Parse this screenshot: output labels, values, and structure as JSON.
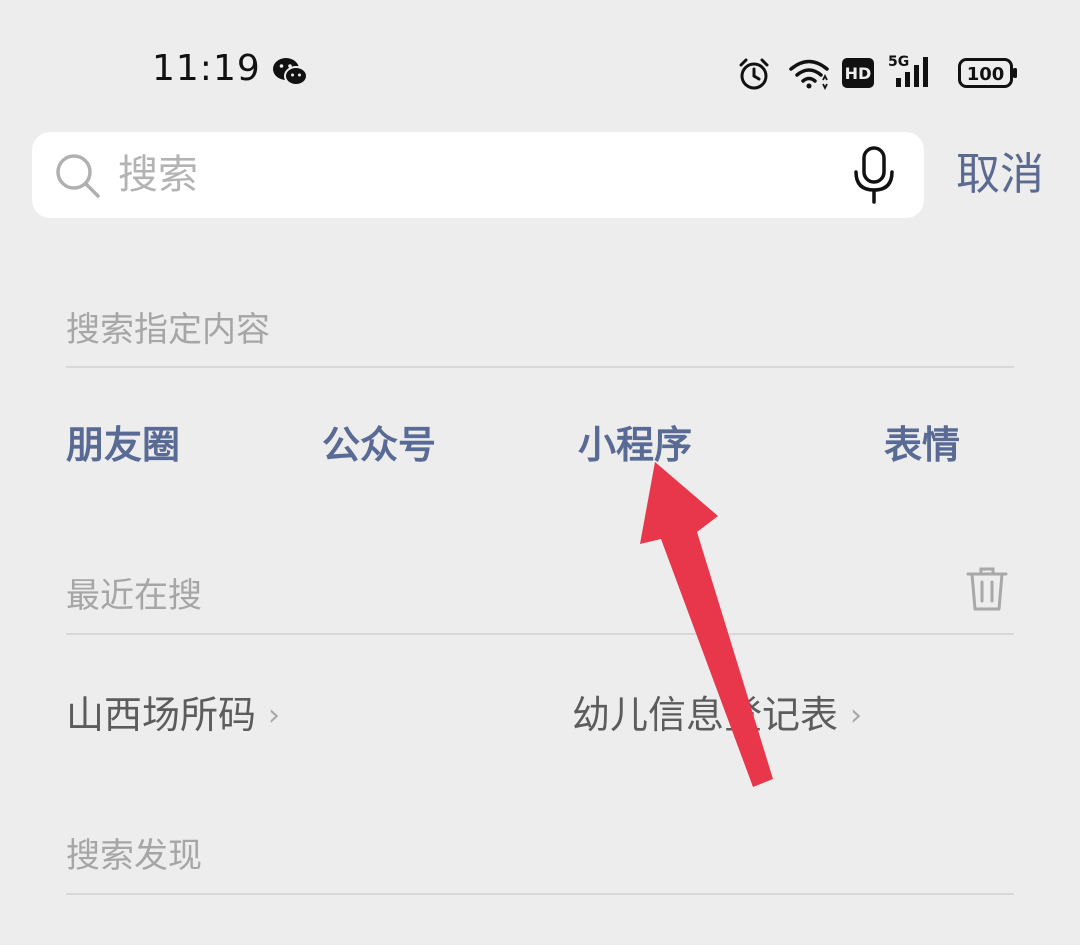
{
  "status_bar": {
    "time": "11:19",
    "battery": "100",
    "network": "5G",
    "hd_label": "HD",
    "icons": [
      "wechat-icon",
      "alarm-icon",
      "wifi-icon",
      "hd-icon",
      "signal-5g-icon",
      "battery-icon"
    ]
  },
  "search": {
    "placeholder": "搜索",
    "value": "",
    "cancel_label": "取消",
    "icons": [
      "search-icon",
      "microphone-icon"
    ]
  },
  "specified": {
    "title": "搜索指定内容",
    "items": [
      "朋友圈",
      "公众号",
      "小程序",
      "表情"
    ]
  },
  "recent": {
    "title": "最近在搜",
    "items": [
      "山西场所码",
      "幼儿信息登记表"
    ],
    "icons": [
      "trash-icon",
      "chevron-right-icon"
    ]
  },
  "discover": {
    "title": "搜索发现"
  },
  "colors": {
    "background": "#ededed",
    "link": "#596a95",
    "muted": "#a6a6a6",
    "arrow": "#e8364b"
  }
}
